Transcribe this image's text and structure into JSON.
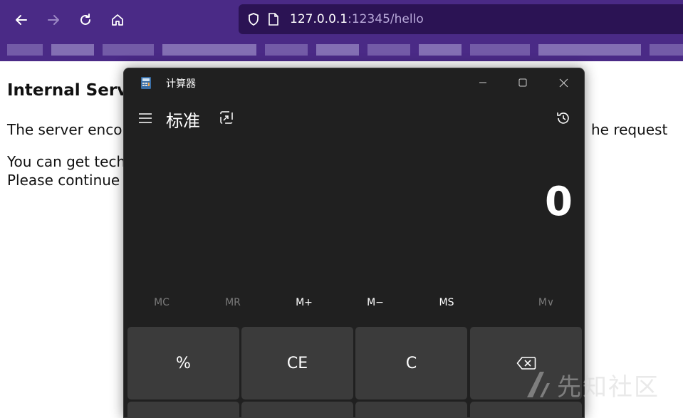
{
  "browser": {
    "url_host": "127.0.0.1",
    "url_rest": ":12345/hello",
    "icons": [
      "back-arrow-icon",
      "forward-arrow-icon",
      "reload-icon",
      "home-icon",
      "shield-icon",
      "page-icon"
    ],
    "accent": "#4a2a86"
  },
  "page": {
    "title": "Internal Serve",
    "line1_left": "The server encou",
    "line1_right": "he request",
    "line2": "You can get techr",
    "line3": "Please continue y"
  },
  "calculator": {
    "window_title": "计算器",
    "mode": "标准",
    "display": "0",
    "memory": [
      {
        "label": "MC",
        "enabled": false
      },
      {
        "label": "MR",
        "enabled": false
      },
      {
        "label": "M+",
        "enabled": true
      },
      {
        "label": "M−",
        "enabled": true
      },
      {
        "label": "MS",
        "enabled": true
      },
      {
        "label": "M∨",
        "enabled": false
      }
    ],
    "keys": [
      "%",
      "CE",
      "C",
      "⌫"
    ],
    "background": "#202020",
    "key_color": "#3b3b3b"
  },
  "watermark": {
    "text": "先知社区"
  }
}
